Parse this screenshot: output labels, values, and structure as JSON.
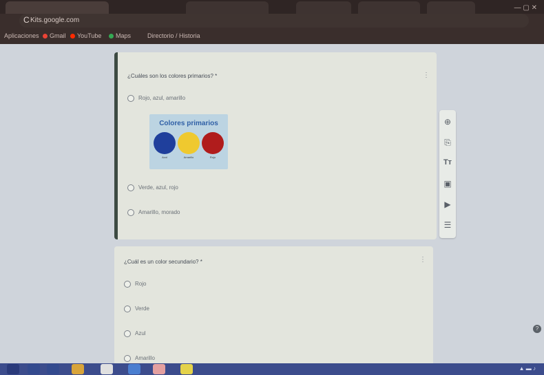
{
  "browser": {
    "tab_title": "Kits.google.com",
    "url": "",
    "bookmarks": [
      "Aplicaciones",
      "Gmail",
      "YouTube",
      "Maps",
      "Directorio / Historia"
    ]
  },
  "form": {
    "questions": [
      {
        "title": "¿Cuáles son los colores primarios? *",
        "options": [
          "Rojo, azul, amarillo",
          "Verde, azul, rojo",
          "Amarillo, morado"
        ],
        "image": {
          "title": "Colores primarios",
          "colors": [
            "#1f3f9c",
            "#efc92f",
            "#b01c1c"
          ],
          "labels": [
            "Azul",
            "Amarillo",
            "Rojo"
          ]
        }
      },
      {
        "title": "¿Cuál es un color secundario? *",
        "options": [
          "Rojo",
          "Verde",
          "Azul",
          "Amarillo"
        ]
      }
    ]
  },
  "toolbar": {
    "icons": [
      "add-question-icon",
      "import-questions-icon",
      "add-title-icon",
      "add-image-icon",
      "add-video-icon",
      "add-section-icon"
    ]
  },
  "help_label": "?"
}
